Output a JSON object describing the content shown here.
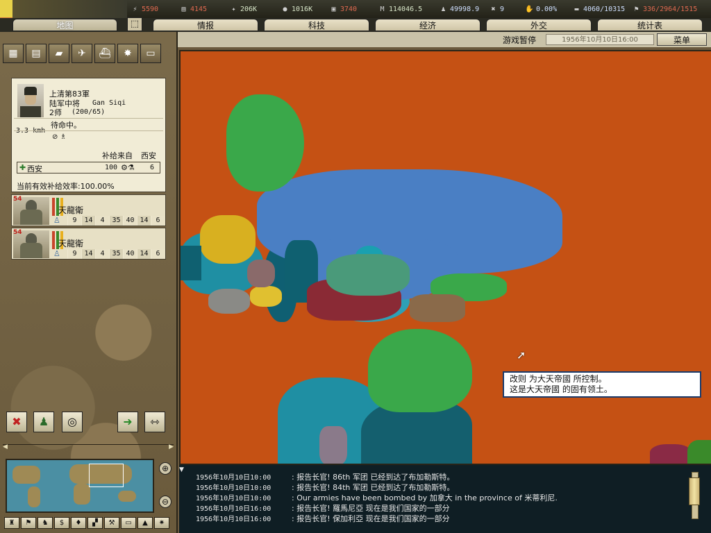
{
  "resources": [
    {
      "icon": "energy-icon",
      "glyph": "⚡",
      "value": "5590",
      "cls": "red"
    },
    {
      "icon": "metal-icon",
      "glyph": "▤",
      "value": "4145",
      "cls": "red"
    },
    {
      "icon": "rare-materials-icon",
      "glyph": "✦",
      "value": "206K",
      "cls": ""
    },
    {
      "icon": "oil-icon",
      "glyph": "●",
      "value": "1016K",
      "cls": ""
    },
    {
      "icon": "supplies-icon",
      "glyph": "▣",
      "value": "3740",
      "cls": "red"
    },
    {
      "icon": "money-icon",
      "glyph": "M",
      "value": "114046.5",
      "cls": ""
    },
    {
      "icon": "manpower-icon",
      "glyph": "♟",
      "value": "49998.9",
      "cls": "blue"
    },
    {
      "icon": "transports-icon",
      "glyph": "✖",
      "value": "9",
      "cls": "blue"
    },
    {
      "icon": "dissent-icon",
      "glyph": "✋",
      "value": "0.00%",
      "cls": "blue"
    },
    {
      "icon": "convoy-icon",
      "glyph": "▬",
      "value": "4060/10315",
      "cls": "blue"
    },
    {
      "icon": "escorts-icon",
      "glyph": "⚑",
      "value": "336/2964/1515",
      "cls": "red"
    }
  ],
  "tabs": [
    "地图",
    "情报",
    "科技",
    "经济",
    "外交",
    "统计表"
  ],
  "status": {
    "paused": "游戏暂停",
    "date": "1956年10月10日16:00",
    "menu": "菜单"
  },
  "unit": {
    "name": "上清第83軍",
    "rank": "陆军中将",
    "leader": "Gan Siqi",
    "divisions": "2师",
    "strength": "(200/65)",
    "speed": "3.3 kmh",
    "status": "待命中。",
    "supply_from_label": "补给来自",
    "supply_from": "西安",
    "supply_city": "西安",
    "supply_value": "100",
    "supply_days": "6",
    "efficiency": "当前有效补给效率:100.00%"
  },
  "divisions": [
    {
      "strength": "54",
      "name": "天龍衛",
      "stats": [
        "9",
        "14",
        "4",
        "35",
        "40",
        "14",
        "6"
      ]
    },
    {
      "strength": "54",
      "name": "天龍衛",
      "stats": [
        "9",
        "14",
        "4",
        "35",
        "40",
        "14",
        "6"
      ]
    }
  ],
  "tooltip": {
    "line1": "改则 为大天帝國 所控制。",
    "line2": "这是大天帝國 的固有领土。"
  },
  "log": [
    {
      "date": "1956年10月10日10:00",
      "text": ": 报告长官! 86th 军团 已经到达了布加勒斯特。"
    },
    {
      "date": "1956年10月10日10:00",
      "text": ": 报告长官! 84th 军团 已经到达了布加勒斯特。"
    },
    {
      "date": "1956年10月10日10:00",
      "text": ": Our armies have been bombed by 加拿大  in the province of 米蒂利尼."
    },
    {
      "date": "1956年10月10日16:00",
      "text": ": 报告长官! 羅馬尼亞 现在是我们国家的一部分"
    },
    {
      "date": "1956年10月10日16:00",
      "text": ": 报告长官! 保加利亞 现在是我们国家的一部分"
    }
  ]
}
